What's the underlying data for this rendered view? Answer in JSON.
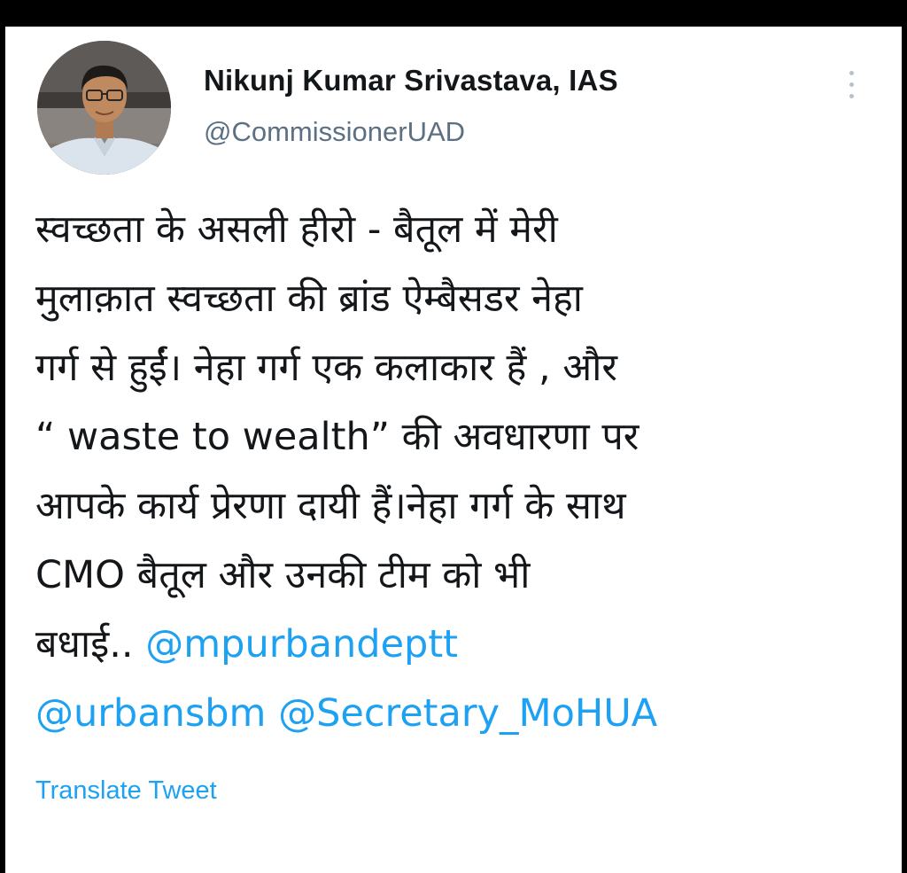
{
  "author": {
    "name": "Nikunj Kumar Srivastava, IAS",
    "handle": "@CommissionerUAD"
  },
  "tweet": {
    "lines": [
      "स्वच्छता  के असली हीरो - बैतूल में मेरी",
      "मुलाक़ात स्वच्छता की ब्रांड ऐम्बैसडर नेहा",
      "गर्ग से हुईं। नेहा गर्ग एक कलाकार हैं , और",
      "“ waste to wealth” की अवधारणा पर",
      "आपके कार्य प्रेरणा दायी हैं।नेहा गर्ग के साथ",
      "CMO बैतूल और उनकी टीम को भी"
    ],
    "line7_text": "बधाई.. ",
    "mentions": [
      "@mpurbandeptt",
      "@urbansbm",
      "@Secretary_MoHUA"
    ]
  },
  "actions": {
    "translate_label": "Translate Tweet"
  },
  "icons": {
    "more": "more-vertical-icon",
    "avatar": "profile-photo"
  },
  "colors": {
    "link": "#1da1f2",
    "text": "#14171a",
    "secondary": "#5b7083",
    "background": "#ffffff",
    "frame": "#000000"
  }
}
